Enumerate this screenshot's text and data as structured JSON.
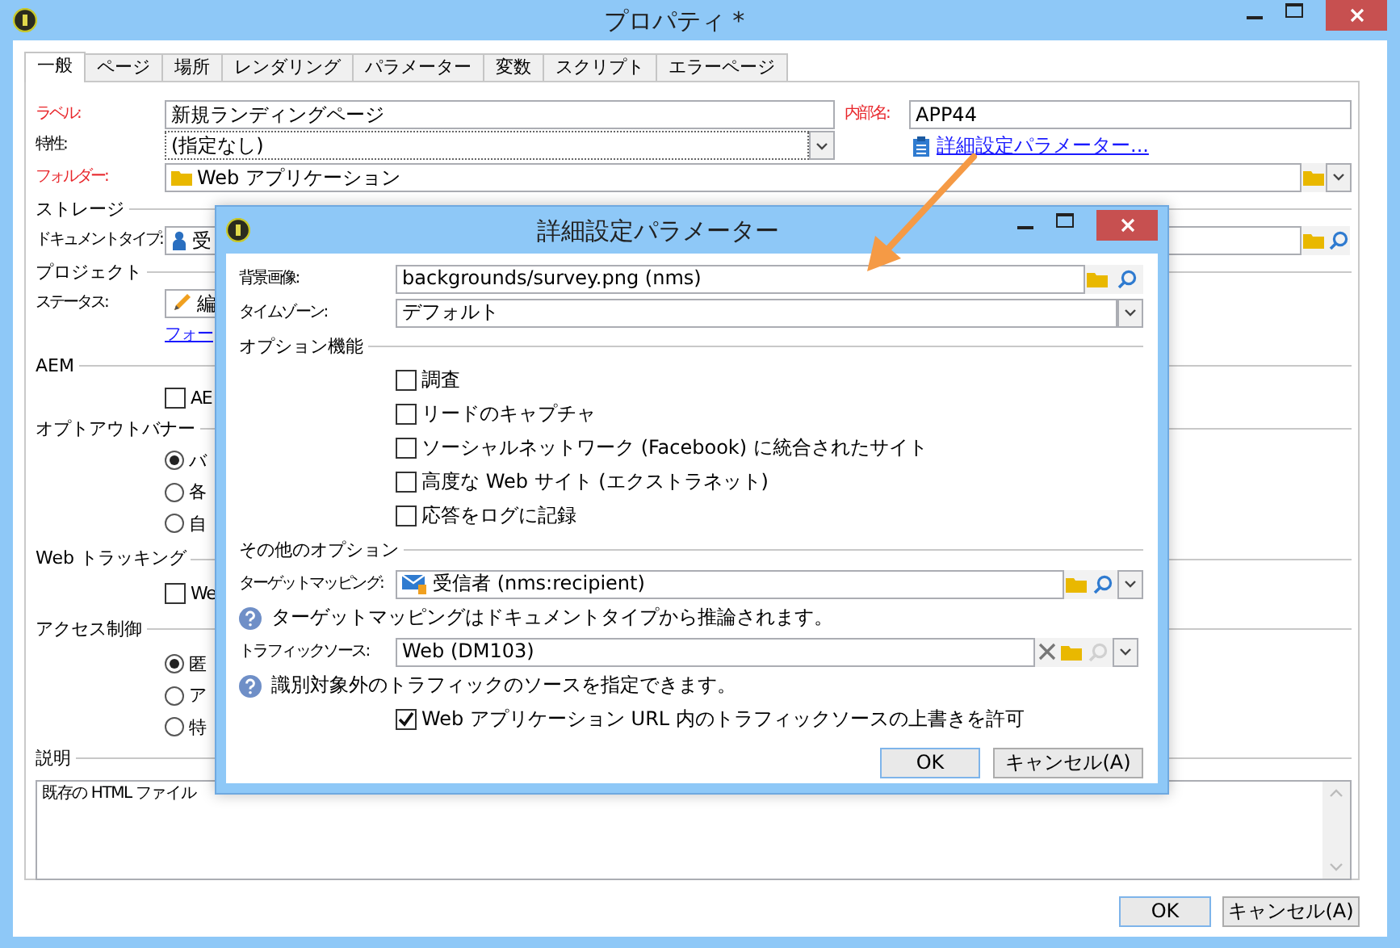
{
  "window": {
    "title": "プロパティ *"
  },
  "tabs": [
    {
      "label": "一般",
      "selected": true
    },
    {
      "label": "ページ",
      "selected": false
    },
    {
      "label": "場所",
      "selected": false
    },
    {
      "label": "レンダリング",
      "selected": false
    },
    {
      "label": "パラメーター",
      "selected": false
    },
    {
      "label": "変数",
      "selected": false
    },
    {
      "label": "スクリプト",
      "selected": false
    },
    {
      "label": "エラーページ",
      "selected": false
    }
  ],
  "general": {
    "label_field": {
      "label": "ラベル:",
      "required": true,
      "value": "新規ランディングページ"
    },
    "internal_name": {
      "label": "内部名:",
      "required": true,
      "value": "APP44"
    },
    "characteristic": {
      "label": "特性:",
      "required": false,
      "value": "(指定なし)"
    },
    "advanced_link": "詳細設定パラメーター...",
    "folder": {
      "label": "フォルダー:",
      "required": true,
      "value": "Web アプリケーション"
    },
    "sections": [
      {
        "title": "ストレージ",
        "rows": [
          {
            "kind": "picker",
            "label": "ドキュメントタイプ:",
            "value": "受"
          }
        ]
      },
      {
        "title": "プロジェクト",
        "rows": [
          {
            "kind": "status",
            "label": "ステータス:",
            "value": "編"
          },
          {
            "kind": "link",
            "text": "フォー"
          }
        ]
      },
      {
        "title": "AEM",
        "rows": [
          {
            "kind": "checkbox",
            "text": "AE",
            "checked": false
          }
        ]
      },
      {
        "title": "オプトアウトバナー",
        "rows": [
          {
            "kind": "radio",
            "text": "バ",
            "selected": true
          },
          {
            "kind": "radio",
            "text": "各",
            "selected": false
          },
          {
            "kind": "radio",
            "text": "自",
            "selected": false
          }
        ]
      },
      {
        "title": "Web トラッキング",
        "rows": [
          {
            "kind": "checkbox",
            "text": "We",
            "checked": false
          }
        ]
      },
      {
        "title": "アクセス制御",
        "rows": [
          {
            "kind": "radio",
            "text": "匿",
            "selected": true
          },
          {
            "kind": "radio",
            "text": "ア",
            "selected": false
          },
          {
            "kind": "radio",
            "text": "特",
            "selected": false
          }
        ]
      },
      {
        "title": "説明",
        "rows": [
          {
            "kind": "textarea",
            "value": "既存の HTML ファイル"
          }
        ]
      }
    ]
  },
  "buttons": [
    "OK",
    "キャンセル(A)"
  ],
  "dialog": {
    "title": "詳細設定パラメーター",
    "background_image": {
      "label": "背景画像:",
      "value": "backgrounds/survey.png (nms)"
    },
    "timezone": {
      "label": "タイムゾーン:",
      "value": "デフォルト"
    },
    "options_title": "オプション機能",
    "options": [
      {
        "label": "調査",
        "checked": false
      },
      {
        "label": "リードのキャプチャ",
        "checked": false
      },
      {
        "label": "ソーシャルネットワーク (Facebook) に統合されたサイト",
        "checked": false
      },
      {
        "label": "高度な Web サイト (エクストラネット)",
        "checked": false
      },
      {
        "label": "応答をログに記録",
        "checked": false
      }
    ],
    "other_title": "その他のオプション",
    "target_mapping": {
      "label": "ターゲットマッピング:",
      "value": "受信者 (nms:recipient)"
    },
    "target_hint": "ターゲットマッピングはドキュメントタイプから推論されます。",
    "traffic_source": {
      "label": "トラフィックソース:",
      "value": "Web (DM103)"
    },
    "traffic_hint": "識別対象外のトラフィックのソースを指定できます。",
    "override": {
      "label": "Web アプリケーション URL 内のトラフィックソースの上書きを許可",
      "checked": true
    },
    "buttons": [
      "OK",
      "キャンセル(A)"
    ]
  }
}
